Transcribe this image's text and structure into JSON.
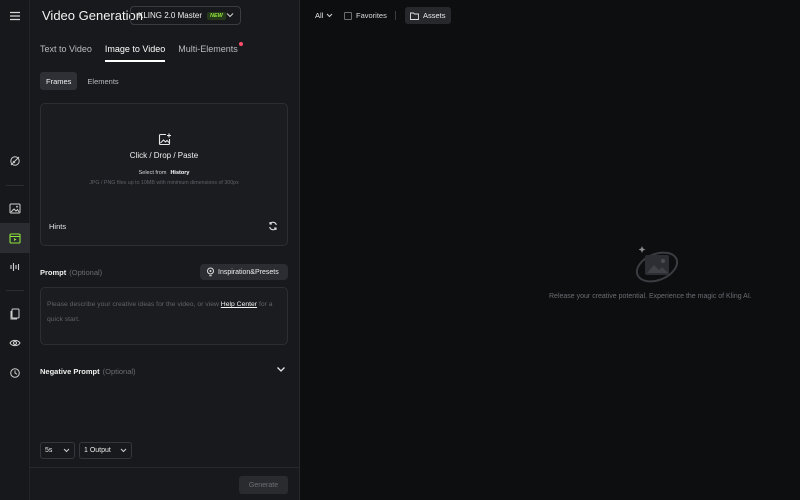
{
  "header": {
    "title": "Video Generation",
    "model": "KLING 2.0 Master",
    "model_badge": "NEW"
  },
  "tabs": [
    {
      "label": "Text to Video"
    },
    {
      "label": "Image to Video"
    },
    {
      "label": "Multi-Elements"
    }
  ],
  "subtabs": [
    {
      "label": "Frames"
    },
    {
      "label": "Elements"
    }
  ],
  "upload": {
    "title": "Click / Drop / Paste",
    "select_from": "Select from",
    "history": "History",
    "hint": "JPG / PNG files up to 10MB with minimum dimensions of 300px",
    "hints_label": "Hints"
  },
  "prompt": {
    "label": "Prompt",
    "optional": "(Optional)",
    "inspiration": "Inspiration&Presets",
    "placeholder_pre": "Please describe your creative ideas for the video, or view",
    "help_link": "Help Center",
    "placeholder_post": "for a quick start."
  },
  "negative_prompt": {
    "label": "Negative Prompt",
    "optional": "(Optional)"
  },
  "footer": {
    "duration": "5s",
    "outputs": "1 Output",
    "generate": "Generate"
  },
  "main": {
    "filter_all": "All",
    "favorites": "Favorites",
    "assets": "Assets",
    "empty_text": "Release your creative potential. Experience the magic of Kling AI."
  },
  "icons": [
    "menu-icon",
    "explore-icon",
    "image-icon",
    "video-icon",
    "audio-icon",
    "assets-icon",
    "eye-icon",
    "history-icon",
    "image-plus-icon",
    "refresh-icon",
    "lightbulb-icon",
    "chevron-down-icon",
    "folder-icon"
  ],
  "colors": {
    "accent_new": "#8fe43b",
    "notification_dot": "#ff4d6d"
  }
}
